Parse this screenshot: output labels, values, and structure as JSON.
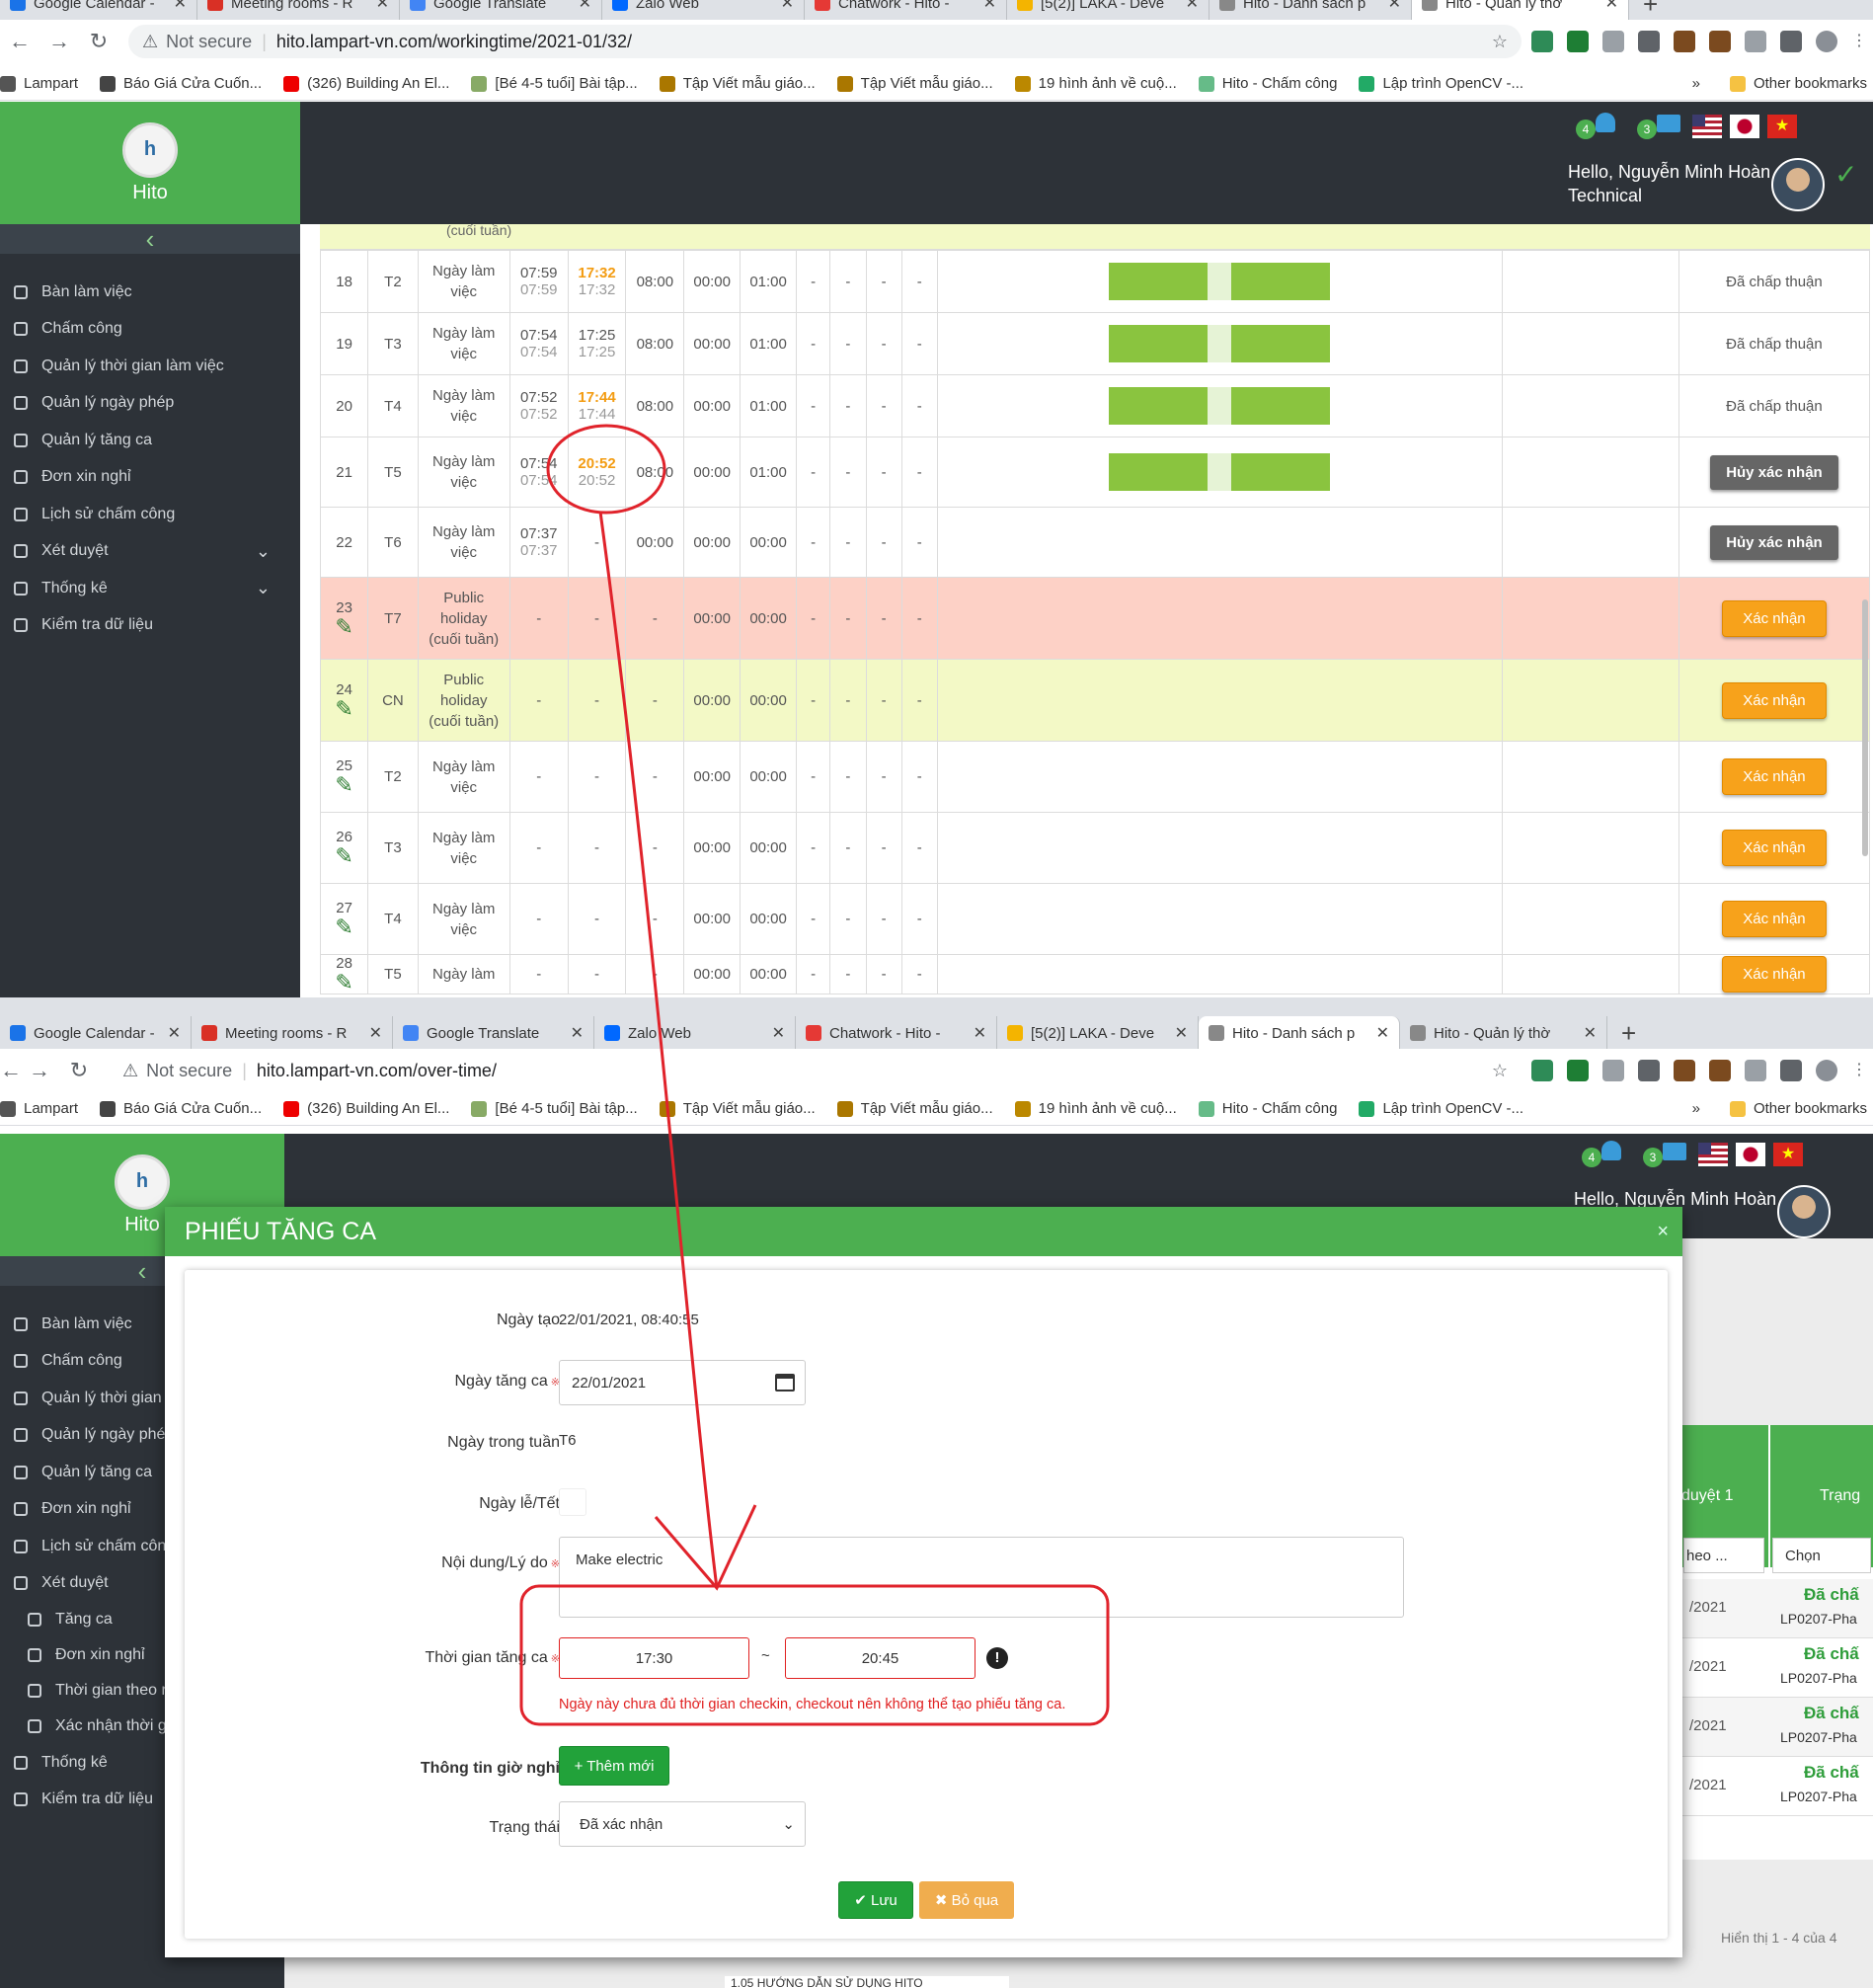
{
  "top": {
    "tabs": [
      {
        "label": "Google Calendar -",
        "color": "#1a73e8"
      },
      {
        "label": "Meeting rooms - R",
        "color": "#d93025"
      },
      {
        "label": "Google Translate",
        "color": "#4285f4"
      },
      {
        "label": "Zalo Web",
        "color": "#0068ff"
      },
      {
        "label": "Chatwork - Hito - ",
        "color": "#e53935"
      },
      {
        "label": "[5(2)] LAKA - Deve",
        "color": "#f4b400"
      },
      {
        "label": "Hito - Danh sách p",
        "color": "#888888"
      },
      {
        "label": "Hito - Quản lý thờ",
        "color": "#888888"
      }
    ],
    "url_prefix": "Not secure",
    "url": "hito.lampart-vn.com/workingtime/2021-01/32/",
    "bookmarks": [
      "Lampart",
      "Báo Giá Cửa Cuốn...",
      "(326) Building An El...",
      "[Bé 4-5 tuổi] Bài tập...",
      "Tập Viết mẫu giáo...",
      "Tập Viết mẫu giáo...",
      "19 hình ảnh về cuộ...",
      "Hito - Chấm công",
      "Lập trình OpenCV -..."
    ],
    "bookmarks_more": "»",
    "other_bookmarks": "Other bookmarks",
    "brand": "Hito",
    "notif_count": "4",
    "mail_count": "3",
    "hello": "Hello, Nguyễn Minh Hoàn",
    "role": "Technical",
    "menu": [
      {
        "label": "Bàn làm việc",
        "chev": ""
      },
      {
        "label": "Chấm công",
        "chev": ""
      },
      {
        "label": "Quản lý thời gian làm việc",
        "chev": ""
      },
      {
        "label": "Quản lý ngày phép",
        "chev": ""
      },
      {
        "label": "Quản lý tăng ca",
        "chev": ""
      },
      {
        "label": "Đơn xin nghỉ",
        "chev": ""
      },
      {
        "label": "Lịch sử chấm công",
        "chev": ""
      },
      {
        "label": "Xét duyệt",
        "chev": "⌄"
      },
      {
        "label": "Thống kê",
        "chev": "⌄"
      },
      {
        "label": "Kiểm tra dữ liệu",
        "chev": ""
      }
    ],
    "prev_row_tail": "(cuối tuần)",
    "rows": [
      {
        "day": "18",
        "wd": "T2",
        "type": "Ngày làm việc",
        "in1": "07:59",
        "in2": "07:59",
        "out1": "17:32",
        "out2": "17:32",
        "out_hl": true,
        "c1": "08:00",
        "c2": "00:00",
        "c3": "01:00",
        "action": "Đã chấp thuận",
        "bar": true,
        "cls": ""
      },
      {
        "day": "19",
        "wd": "T3",
        "type": "Ngày làm việc",
        "in1": "07:54",
        "in2": "07:54",
        "out1": "17:25",
        "out2": "17:25",
        "out_hl": false,
        "c1": "08:00",
        "c2": "00:00",
        "c3": "01:00",
        "action": "Đã chấp thuận",
        "bar": true,
        "cls": ""
      },
      {
        "day": "20",
        "wd": "T4",
        "type": "Ngày làm việc",
        "in1": "07:52",
        "in2": "07:52",
        "out1": "17:44",
        "out2": "17:44",
        "out_hl": true,
        "c1": "08:00",
        "c2": "00:00",
        "c3": "01:00",
        "action": "Đã chấp thuận",
        "bar": true,
        "cls": ""
      },
      {
        "day": "21",
        "wd": "T5",
        "type": "Ngày làm việc",
        "in1": "07:54",
        "in2": "07:54",
        "out1": "20:52",
        "out2": "20:52",
        "out_hl": true,
        "c1": "08:00",
        "c2": "00:00",
        "c3": "01:00",
        "action": "Hủy xác nhận",
        "bar": true,
        "cls": ""
      },
      {
        "day": "22",
        "wd": "T6",
        "type": "Ngày làm việc",
        "in1": "07:37",
        "in2": "07:37",
        "out1": "-",
        "out2": "",
        "out_hl": false,
        "c1": "00:00",
        "c2": "00:00",
        "c3": "00:00",
        "action": "Hủy xác nhận",
        "bar": false,
        "cls": ""
      },
      {
        "day": "23",
        "wd": "T7",
        "type": "Public holiday (cuối tuần)",
        "in1": "-",
        "in2": "",
        "out1": "-",
        "out2": "",
        "out_hl": false,
        "c1": "-",
        "c2": "00:00",
        "c3": "00:00",
        "action": "Xác nhận",
        "bar": false,
        "cls": "pink"
      },
      {
        "day": "24",
        "wd": "CN",
        "type": "Public holiday (cuối tuần)",
        "in1": "-",
        "in2": "",
        "out1": "-",
        "out2": "",
        "out_hl": false,
        "c1": "-",
        "c2": "00:00",
        "c3": "00:00",
        "action": "Xác nhận",
        "bar": false,
        "cls": "yellow"
      },
      {
        "day": "25",
        "wd": "T2",
        "type": "Ngày làm việc",
        "in1": "-",
        "in2": "",
        "out1": "-",
        "out2": "",
        "out_hl": false,
        "c1": "-",
        "c2": "00:00",
        "c3": "00:00",
        "action": "Xác nhận",
        "bar": false,
        "cls": ""
      },
      {
        "day": "26",
        "wd": "T3",
        "type": "Ngày làm việc",
        "in1": "-",
        "in2": "",
        "out1": "-",
        "out2": "",
        "out_hl": false,
        "c1": "-",
        "c2": "00:00",
        "c3": "00:00",
        "action": "Xác nhận",
        "bar": false,
        "cls": ""
      },
      {
        "day": "27",
        "wd": "T4",
        "type": "Ngày làm việc",
        "in1": "-",
        "in2": "",
        "out1": "-",
        "out2": "",
        "out_hl": false,
        "c1": "-",
        "c2": "00:00",
        "c3": "00:00",
        "action": "Xác nhận",
        "bar": false,
        "cls": ""
      },
      {
        "day": "28",
        "wd": "T5",
        "type": "Ngày làm",
        "in1": "-",
        "in2": "",
        "out1": "-",
        "out2": "",
        "out_hl": false,
        "c1": "-",
        "c2": "00:00",
        "c3": "00:00",
        "action": "Xác nhận",
        "bar": false,
        "cls": ""
      }
    ],
    "dash": "-"
  },
  "bottom": {
    "url": "hito.lampart-vn.com/over-time/",
    "menu": [
      {
        "label": "Bàn làm việc"
      },
      {
        "label": "Chấm công"
      },
      {
        "label": "Quản lý thời gian làm"
      },
      {
        "label": "Quản lý ngày phép"
      },
      {
        "label": "Quản lý tăng ca"
      },
      {
        "label": "Đơn xin nghỉ"
      },
      {
        "label": "Lịch sử chấm công"
      },
      {
        "label": "Xét duyệt"
      },
      {
        "label": "Tăng ca"
      },
      {
        "label": "Đơn xin nghỉ"
      },
      {
        "label": "Thời gian theo r"
      },
      {
        "label": "Xác nhận thời g"
      },
      {
        "label": "Thống kê"
      },
      {
        "label": "Kiểm tra dữ liệu"
      }
    ],
    "bg_table": {
      "head1": "duyệt 1",
      "head2": "Trạng",
      "filter1": "heo ...",
      "filter2": "Chọn",
      "rows": [
        {
          "date": "/2021",
          "status": "Đã chấ",
          "code": "LP0207-Pha"
        },
        {
          "date": "/2021",
          "status": "Đã chấ",
          "code": "LP0207-Pha"
        },
        {
          "date": "/2021",
          "status": "Đã chấ",
          "code": "LP0207-Pha"
        },
        {
          "date": "/2021",
          "status": "Đã chấ",
          "code": "LP0207-Pha"
        }
      ],
      "footer": "Hiển thị 1 - 4 của 4"
    },
    "modal": {
      "title": "PHIẾU TĂNG CA",
      "close": "×",
      "created_label": "Ngày tạo",
      "created_value": "22/01/2021, 08:40:55",
      "ot_date_label": "Ngày tăng ca",
      "ot_date_value": "22/01/2021",
      "weekday_label": "Ngày trong tuần",
      "weekday_value": "T6",
      "holiday_label": "Ngày lễ/Tết",
      "reason_label": "Nội dung/Lý do",
      "reason_value": "Make electric",
      "time_label": "Thời gian tăng ca",
      "time_from": "17:30",
      "time_sep": "~",
      "time_to": "20:45",
      "error": "Ngày này chưa đủ thời gian checkin, checkout nên không thể tạo phiếu tăng ca.",
      "break_label": "Thông tin giờ nghỉ",
      "add_new": "+ Thêm mới",
      "status_label": "Trạng thái",
      "status_value": "Đã xác nhận",
      "save": "✔ Lưu",
      "cancel": "✖ Bỏ qua",
      "req_mark": "※"
    },
    "bottom_caption": "1.05 HƯỚNG DẪN SỬ DỤNG HITO"
  },
  "colors": {
    "brand_green": "#4caf50",
    "annotation_red": "#e0232b",
    "orange": "#f39c12",
    "pink_row": "#fdd1c6",
    "yellow_row": "#f3f9c6"
  }
}
